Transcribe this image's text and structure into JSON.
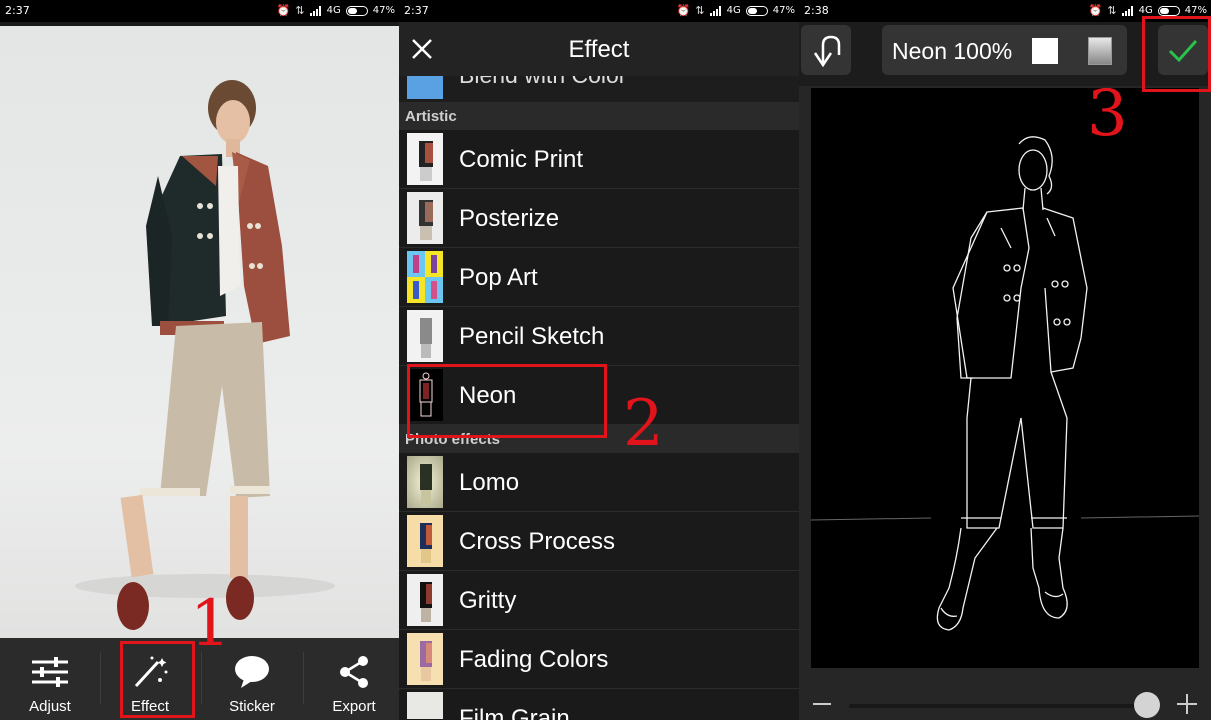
{
  "panel1": {
    "status": {
      "time": "2:37",
      "network": "4G",
      "battery": "47%"
    },
    "toolbar": [
      {
        "label": "Adjust",
        "icon": "adjust-sliders-icon"
      },
      {
        "label": "Effect",
        "icon": "magic-wand-icon"
      },
      {
        "label": "Sticker",
        "icon": "speech-bubble-icon"
      },
      {
        "label": "Export",
        "icon": "share-icon"
      }
    ],
    "annotation": "1"
  },
  "panel2": {
    "status": {
      "time": "2:37",
      "network": "4G",
      "battery": "47%"
    },
    "title": "Effect",
    "partial_top_item": "Blend with Color",
    "sections": [
      {
        "name": "Artistic",
        "items": [
          "Comic Print",
          "Posterize",
          "Pop Art",
          "Pencil Sketch",
          "Neon"
        ]
      },
      {
        "name": "Photo effects",
        "items": [
          "Lomo",
          "Cross Process",
          "Gritty",
          "Fading Colors",
          "Film Grain"
        ]
      }
    ],
    "annotation": "2"
  },
  "panel3": {
    "status": {
      "time": "2:38",
      "network": "4G",
      "battery": "47%"
    },
    "effect_label": "Neon 100%",
    "intensity": 0.96,
    "annotation": "3",
    "colors": {
      "confirm": "#29c24a",
      "annotation": "#e0141a"
    }
  }
}
